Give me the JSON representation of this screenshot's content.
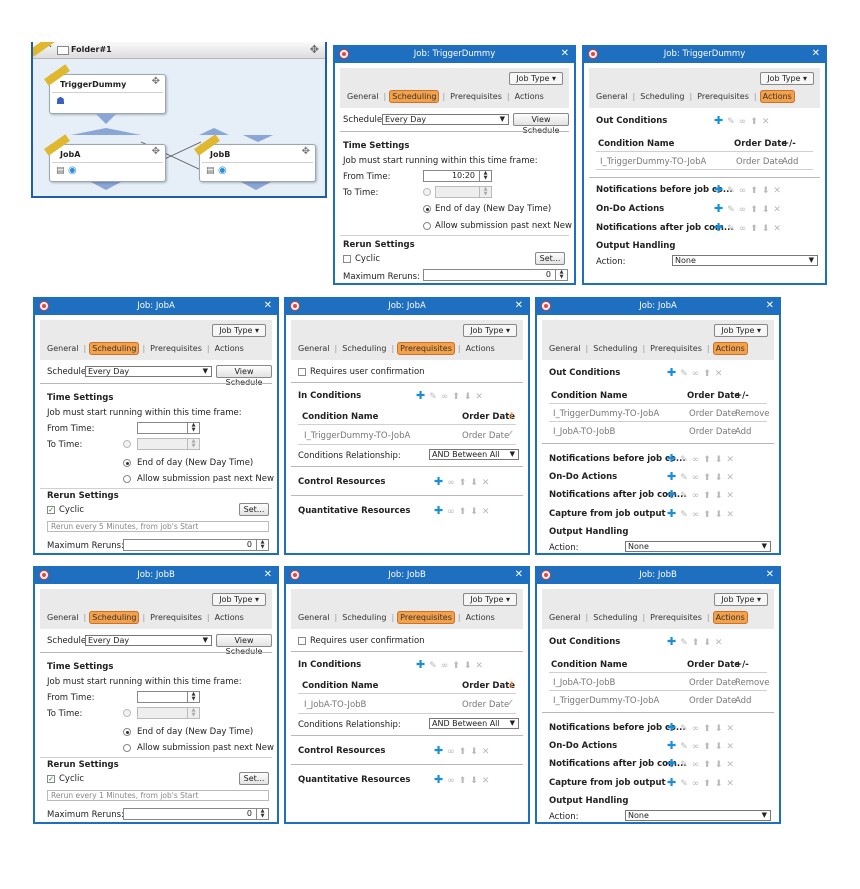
{
  "flow": {
    "folder_name": "Folder#1",
    "jobs": [
      "TriggerDummy",
      "JobA",
      "JobB"
    ]
  },
  "common": {
    "job_type_label": "Job Type",
    "tabs": [
      "General",
      "Scheduling",
      "Prerequisites",
      "Actions"
    ],
    "schedule_label": "Schedule",
    "schedule_value": "Every Day",
    "view_schedule": "View Schedule",
    "time_settings": "Time Settings",
    "time_frame_text": "Job must start running within this time frame:",
    "from_time": "From Time:",
    "to_time": "To Time:",
    "end_of_day": "End of day (New Day Time)",
    "allow_submission": "Allow submission past next New Day...",
    "rerun_settings": "Rerun Settings",
    "cyclic": "Cyclic",
    "set_button": "Set...",
    "maximum_reruns": "Maximum Reruns:",
    "requires_confirmation": "Requires user confirmation",
    "in_conditions": "In Conditions",
    "condition_name": "Condition Name",
    "order_date": "Order Date",
    "plus_minus": "+/-",
    "conditions_relationship": "Conditions Relationship:",
    "and_between_all": "AND Between All",
    "control_resources": "Control Resources",
    "quantitative_resources": "Quantitative Resources",
    "out_conditions": "Out Conditions",
    "notif_before": "Notifications before job co...",
    "on_do_actions": "On-Do Actions",
    "notif_after": "Notifications after job com...",
    "capture_output": "Capture from job output",
    "output_handling": "Output Handling",
    "action_label": "Action:",
    "action_value": "None",
    "remove": "Remove",
    "add": "Add"
  },
  "dialogs": {
    "trigger_sched": {
      "title": "Job: TriggerDummy",
      "from_time": "10:20",
      "max_reruns": "0"
    },
    "trigger_actions": {
      "title": "Job: TriggerDummy",
      "out_row1_name": "I_TriggerDummy-TO-JobA",
      "out_row1_date": "Order Date",
      "out_row1_action": "Add"
    },
    "joba_sched": {
      "title": "Job: JobA",
      "cyclic_text": "Rerun every 5 Minutes, from job's Start",
      "max_reruns": "0"
    },
    "joba_prereq": {
      "title": "Job: JobA",
      "in_row_name": "I_TriggerDummy-TO-JobA",
      "in_row_date": "Order Date"
    },
    "joba_actions": {
      "title": "Job: JobA",
      "row1_name": "I_TriggerDummy-TO-JobA",
      "row1_date": "Order Date",
      "row1_action": "Remove",
      "row2_name": "I_JobA-TO-JobB",
      "row2_date": "Order Date",
      "row2_action": "Add"
    },
    "jobb_sched": {
      "title": "Job: JobB",
      "cyclic_text": "Rerun every 1 Minutes, from job's Start",
      "max_reruns": "0"
    },
    "jobb_prereq": {
      "title": "Job: JobB",
      "in_row_name": "I_JobA-TO-JobB",
      "in_row_date": "Order Date"
    },
    "jobb_actions": {
      "title": "Job: JobB",
      "row1_name": "I_JobA-TO-JobB",
      "row1_date": "Order Date",
      "row1_action": "Remove",
      "row2_name": "I_TriggerDummy-TO-JobA",
      "row2_date": "Order Date",
      "row2_action": "Add"
    }
  }
}
